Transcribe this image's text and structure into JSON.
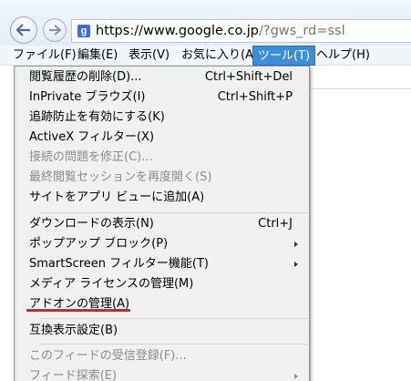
{
  "address_bar": {
    "url_main": "https://www.google.co.jp",
    "url_rest": "/?gws_rd=ssl",
    "favicon_letter": "g",
    "back_icon": "back-arrow-icon",
    "forward_icon": "forward-arrow-icon"
  },
  "menu_bar": {
    "items": [
      {
        "label": "ファイル(F)"
      },
      {
        "label": "編集(E)"
      },
      {
        "label": "表示(V)"
      },
      {
        "label": "お気に入り(A)"
      },
      {
        "label": "ツール(T)"
      },
      {
        "label": "ヘルプ(H)"
      }
    ],
    "active_index": 4
  },
  "dropdown": {
    "items": [
      {
        "label": "閲覧履歴の削除(D)...",
        "shortcut": "Ctrl+Shift+Del"
      },
      {
        "label": "InPrivate ブラウズ(I)",
        "shortcut": "Ctrl+Shift+P"
      },
      {
        "label": "追跡防止を有効にする(K)",
        "shortcut": ""
      },
      {
        "label": "ActiveX フィルター(X)",
        "shortcut": ""
      },
      {
        "label": "接続の問題を修正(C)...",
        "shortcut": "",
        "disabled": true
      },
      {
        "label": "最終閲覧セッションを再度開く(S)",
        "shortcut": "",
        "disabled": true
      },
      {
        "label": "サイトをアプリ ビューに追加(A)",
        "shortcut": ""
      },
      {
        "label": "ダウンロードの表示(N)",
        "shortcut": "Ctrl+J"
      },
      {
        "label": "ポップアップ ブロック(P)",
        "shortcut": "",
        "submenu": true
      },
      {
        "label": "SmartScreen フィルター機能(T)",
        "shortcut": "",
        "submenu": true
      },
      {
        "label": "メディア ライセンスの管理(M)",
        "shortcut": ""
      },
      {
        "label": "アドオンの管理(A)",
        "shortcut": "",
        "highlighted_by_annotation": true
      },
      {
        "label": "互換表示設定(B)",
        "shortcut": ""
      },
      {
        "label": "このフィードの受信登録(F)...",
        "shortcut": "",
        "disabled": true
      },
      {
        "label": "フィード探索(E)",
        "shortcut": "",
        "disabled": true,
        "submenu": true
      }
    ]
  },
  "colors": {
    "menu_active_bg": "#3c8fd6",
    "annotation_underline": "#e0202a",
    "disabled_text": "#8d8d8d"
  }
}
